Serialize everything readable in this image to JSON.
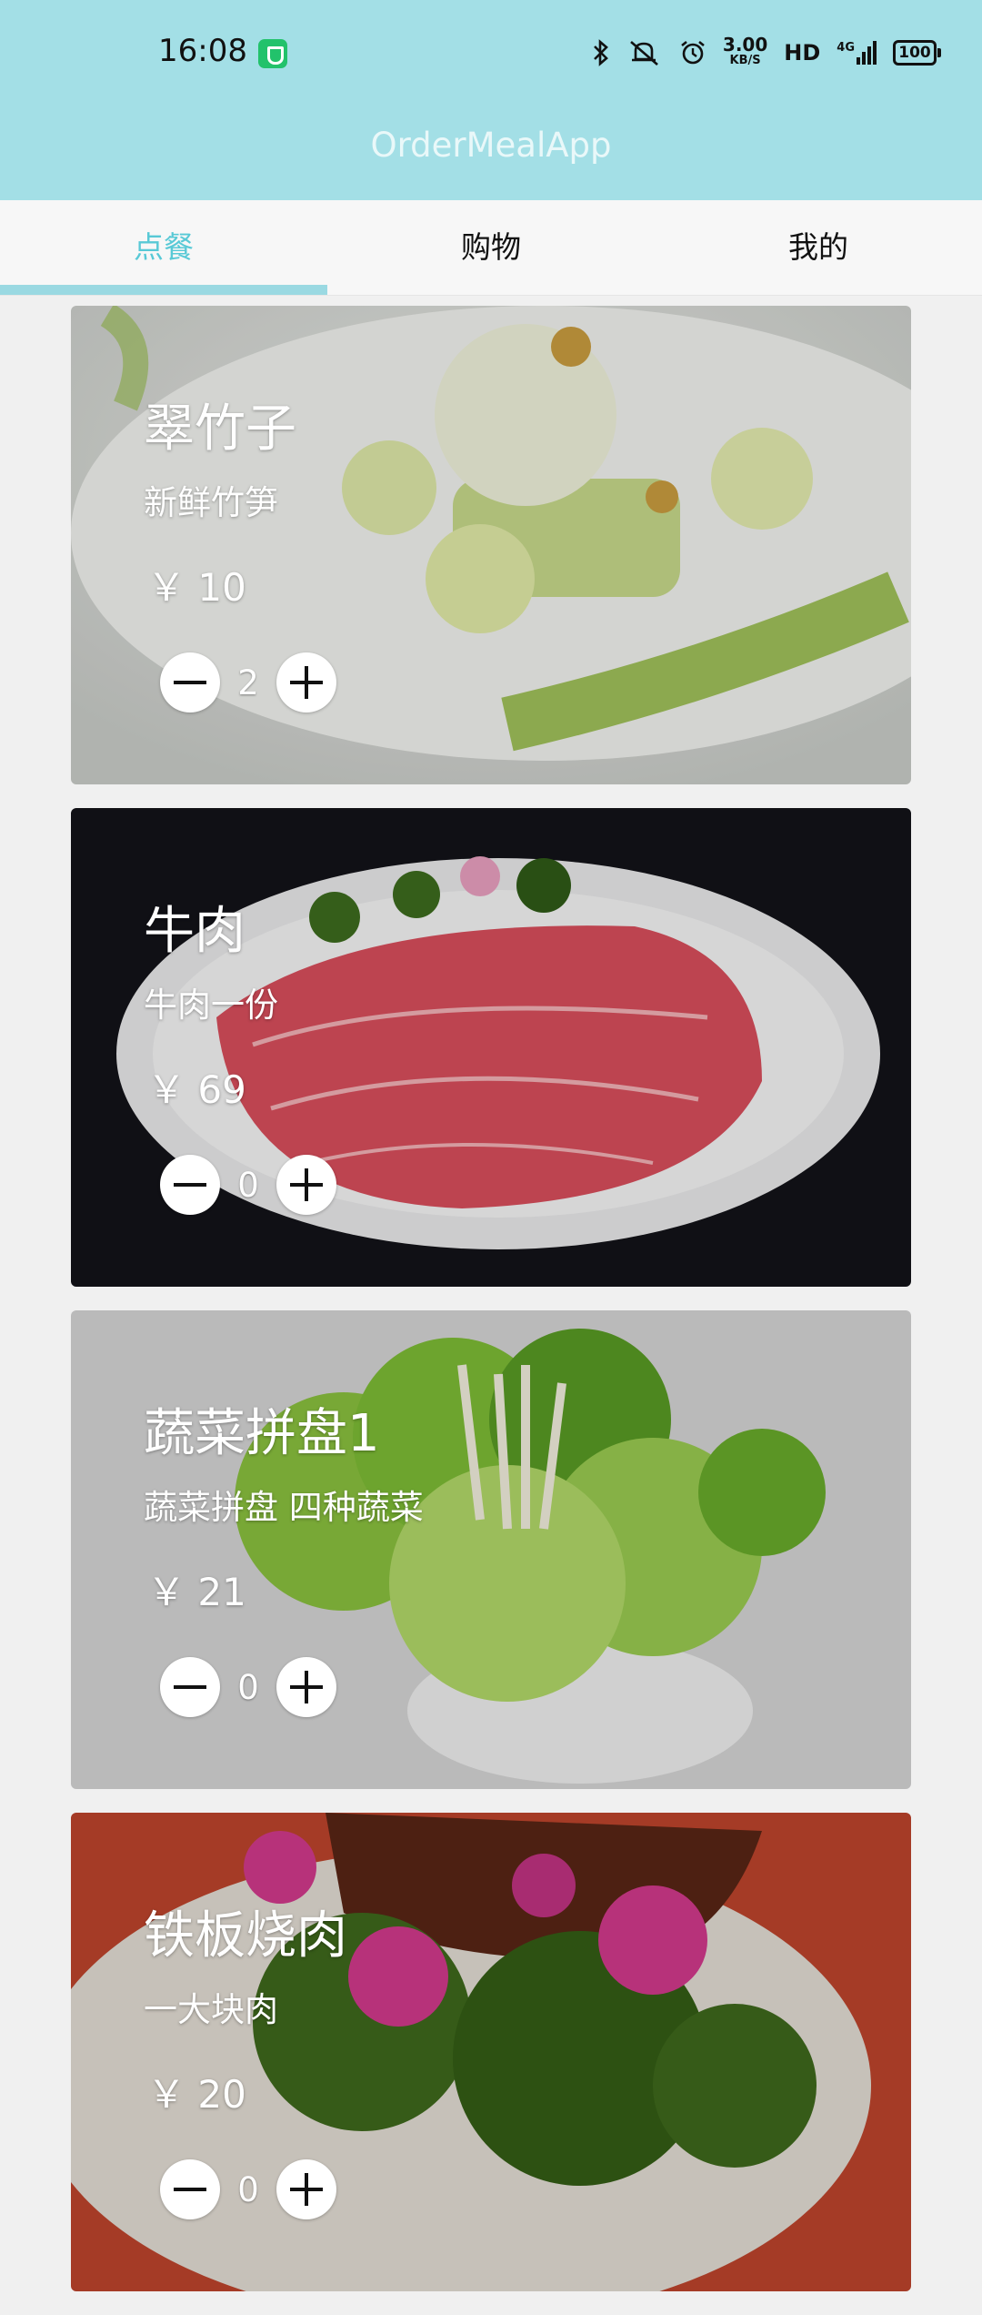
{
  "status_bar": {
    "time": "16:08",
    "speed_value": "3.00",
    "speed_unit": "KB/S",
    "hd": "HD",
    "network": "4G",
    "battery": "100",
    "icons": [
      "bluetooth-icon",
      "silent-icon",
      "alarm-icon",
      "signal-icon",
      "battery-icon"
    ]
  },
  "app": {
    "title": "OrderMealApp",
    "accent": "#58c9d6",
    "appbar_color": "#a3dfe6"
  },
  "tabs": [
    {
      "label": "点餐",
      "active": true
    },
    {
      "label": "购物",
      "active": false
    },
    {
      "label": "我的",
      "active": false
    }
  ],
  "dishes": [
    {
      "name": "翠竹子",
      "desc": "新鲜竹笋",
      "price": "￥ 10",
      "qty": "2"
    },
    {
      "name": "牛肉",
      "desc": "牛肉一份",
      "price": "￥ 69",
      "qty": "0"
    },
    {
      "name": "蔬菜拼盘1",
      "desc": "蔬菜拼盘 四种蔬菜",
      "price": "￥ 21",
      "qty": "0"
    },
    {
      "name": "铁板烧肉",
      "desc": "一大块肉",
      "price": "￥ 20",
      "qty": "0"
    }
  ]
}
